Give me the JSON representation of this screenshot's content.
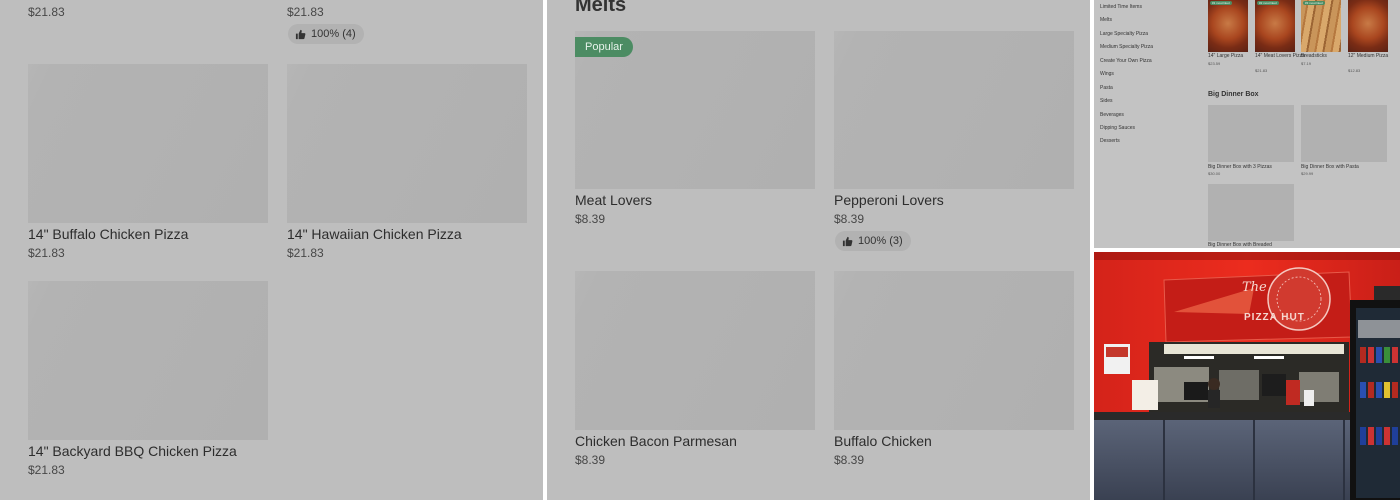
{
  "left": {
    "top_items": [
      {
        "price": "$21.83"
      },
      {
        "price": "$21.83",
        "rating": "100% (4)"
      }
    ],
    "items": [
      {
        "title": "14\" Buffalo Chicken Pizza",
        "price": "$21.83"
      },
      {
        "title": "14\" Hawaiian Chicken Pizza",
        "price": "$21.83"
      },
      {
        "title": "14\" Backyard BBQ Chicken Pizza",
        "price": "$21.83"
      }
    ]
  },
  "middle": {
    "section_title": "Melts",
    "items": [
      {
        "title": "Meat Lovers",
        "price": "$8.39",
        "badge": "Popular"
      },
      {
        "title": "Pepperoni Lovers",
        "price": "$8.39",
        "rating": "100% (3)"
      },
      {
        "title": "Chicken Bacon Parmesan",
        "price": "$8.39"
      },
      {
        "title": "Buffalo Chicken",
        "price": "$8.39"
      }
    ]
  },
  "menu_panel": {
    "nav": [
      "Limited Time Items",
      "Melts",
      "Large Specialty Pizza",
      "Medium Specialty Pizza",
      "Create Your Own Pizza",
      "Wings",
      "Pasta",
      "Sides",
      "Beverages",
      "Dipping Sauces",
      "Desserts"
    ],
    "top_items": [
      {
        "title": "14\" Large Pizza",
        "price": "$23.59",
        "tag": "#1 most liked"
      },
      {
        "title": "14\" Meat Lovers Pizza",
        "price": "$21.83",
        "tag": "#2 most liked"
      },
      {
        "title": "Breadsticks",
        "price": "$7.19",
        "tag": "#3 most liked"
      },
      {
        "title": "12\" Medium Pizza",
        "price": "$12.83"
      }
    ],
    "section_title": "Big Dinner Box",
    "box_items": [
      {
        "title": "Big Dinner Box with 3 Pizzas",
        "price": "$30.00"
      },
      {
        "title": "Big Dinner Box with Pasta",
        "price": "$29.99"
      },
      {
        "title": "Big Dinner Box with Breaded"
      }
    ]
  },
  "photo": {
    "sign_text": "PIZZA HUT",
    "sign_script": "The",
    "colors": {
      "wall": "#e4261a",
      "counter": "#4a5366",
      "banner": "#c0201a"
    }
  },
  "colors": {
    "panel_bg": "#bebebe",
    "thumb": "#b1b1b1",
    "badge": "#4c8c63"
  }
}
